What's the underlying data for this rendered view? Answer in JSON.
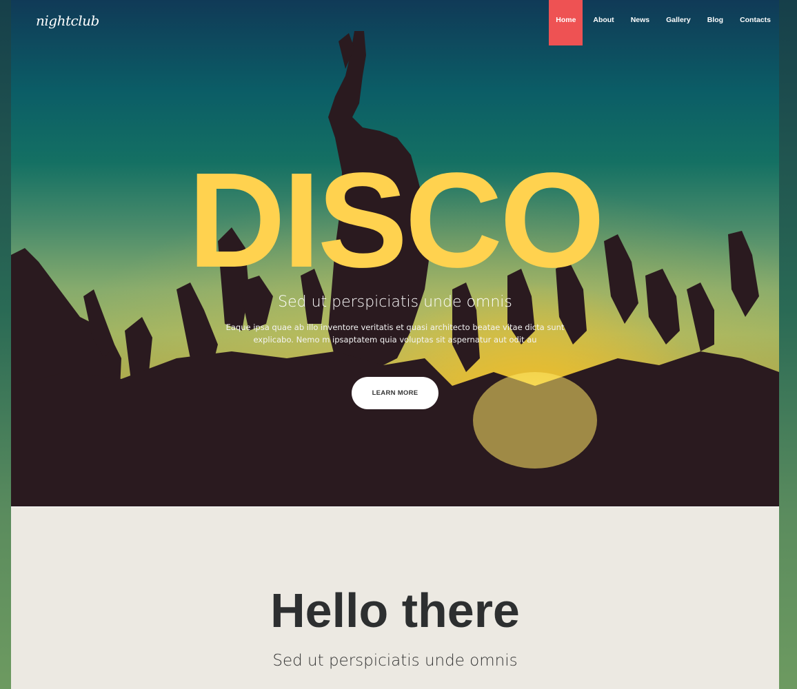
{
  "brand": {
    "logo_text": "nightclub"
  },
  "nav": {
    "items": [
      "Home",
      "About",
      "News",
      "Gallery",
      "Blog",
      "Contacts"
    ],
    "active": "Home",
    "active_color": "#ee5253"
  },
  "hero": {
    "title": "DISCO",
    "subtitle": "Sed ut perspiciatis unde omnis",
    "text": "Eaque ipsa quae ab illo inventore veritatis et quasi architecto beatae vitae dicta sunt explicabo. Nemo m ipsaptatem quia voluptas sit aspernatur aut odit au",
    "button_label": "LEARN MORE",
    "title_color": "#ffd24f"
  },
  "intro": {
    "title": "Hello there",
    "subtitle": "Sed ut perspiciatis unde omnis"
  }
}
